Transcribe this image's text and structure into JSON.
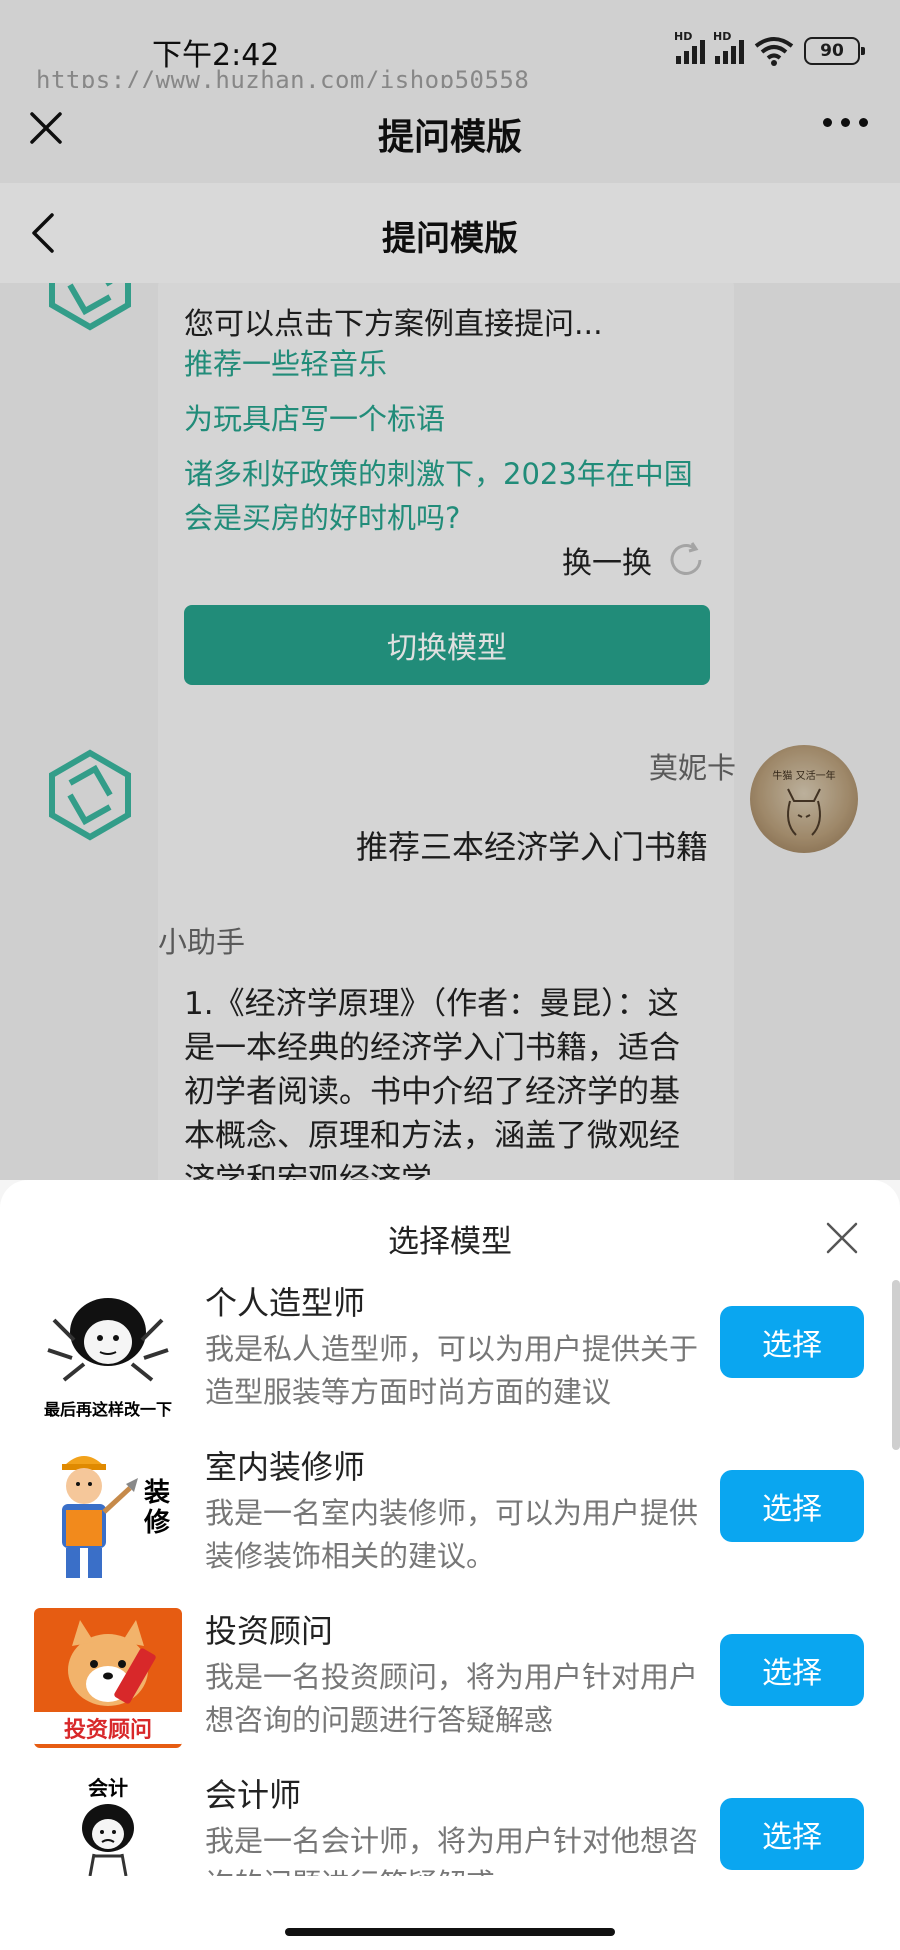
{
  "status_bar": {
    "time": "下午2:42",
    "battery": "90",
    "watermark": "https://www.huzhan.com/ishop50558"
  },
  "top_bar": {
    "title": "提问模版"
  },
  "nav_bar": {
    "title": "提问模版"
  },
  "intro": {
    "text": "您可以点击下方案例直接提问...",
    "suggestions": [
      "推荐一些轻音乐",
      "为玩具店写一个标语",
      "诸多利好政策的刺激下，2023年在中国会是买房的好时机吗?"
    ],
    "refresh_label": "换一换",
    "switch_button": "切换模型"
  },
  "user_message": {
    "name": "莫妮卡",
    "text": "推荐三本经济学入门书籍",
    "avatar_caption": "牛猫 又活一年"
  },
  "bot_message": {
    "name": "小助手",
    "text": "1.《经济学原理》（作者：曼昆）：这是一本经典的经济学入门书籍，适合初学者阅读。书中介绍了经济学的基本概念、原理和方法，涵盖了微观经济学和宏观经济学"
  },
  "sheet": {
    "title": "选择模型",
    "models": [
      {
        "name": "个人造型师",
        "desc": "我是私人造型师，可以为用户提供关于造型服装等方面时尚方面的建议",
        "button": "选择",
        "image_caption": "最后再这样改一下"
      },
      {
        "name": "室内装修师",
        "desc": "我是一名室内装修师，可以为用户提供装修装饰相关的建议。",
        "button": "选择",
        "image_caption": "装修"
      },
      {
        "name": "投资顾问",
        "desc": "我是一名投资顾问，将为用户针对用户想咨询的问题进行答疑解惑",
        "button": "选择",
        "image_caption": "投资顾问"
      },
      {
        "name": "会计师",
        "desc": "我是一名会计师，将为用户针对他想咨询的问题进行答疑解惑",
        "button": "选择",
        "image_caption": "会计"
      }
    ]
  },
  "colors": {
    "accent_green": "#26a08a",
    "select_blue": "#0aa6f0",
    "investment_orange": "#e65c12"
  },
  "icons": [
    "close-icon",
    "more-icon",
    "back-icon",
    "refresh-icon",
    "bot-logo-icon",
    "close-sheet-icon"
  ]
}
